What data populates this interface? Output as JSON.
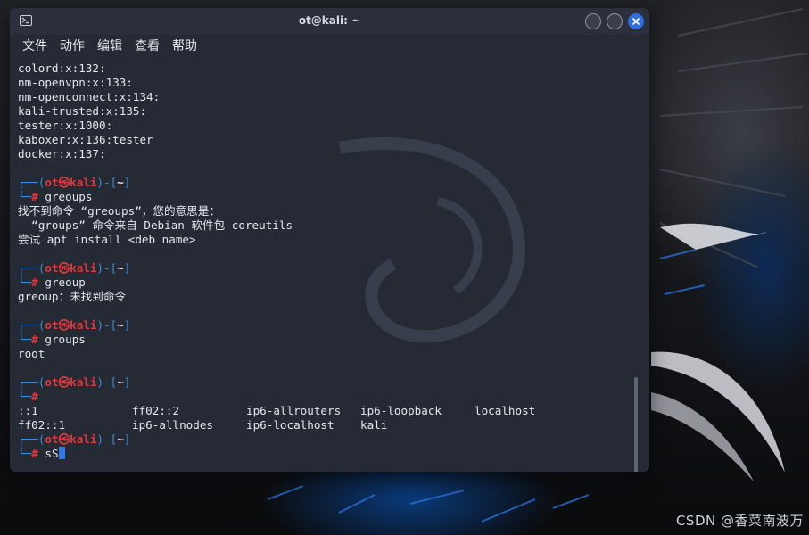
{
  "window": {
    "title": "ot@kali: ~",
    "icon": "terminal-icon",
    "controls": [
      "minimize-button",
      "maximize-button",
      "close-button"
    ]
  },
  "menu": [
    "文件",
    "动作",
    "编辑",
    "查看",
    "帮助"
  ],
  "prompt": {
    "user": "ot",
    "at_symbol": "㉿",
    "host": "kali",
    "dir": "~",
    "symbol": "#"
  },
  "output": {
    "group_lines": [
      "colord:x:132:",
      "nm-openvpn:x:133:",
      "nm-openconnect:x:134:",
      "kali-trusted:x:135:",
      "tester:x:1000:",
      "kaboxer:x:136:tester",
      "docker:x:137:"
    ],
    "cmd1": "greoups",
    "cmd1_out": [
      "找不到命令 “greoups”，您的意思是：",
      "  “groups” 命令来自 Debian 软件包 coreutils",
      "尝试 apt install <deb name>"
    ],
    "cmd2": "greoup",
    "cmd2_out": "greoup：未找到命令",
    "cmd3": "groups",
    "cmd3_out": "root",
    "cmd4": "",
    "completion_row1": [
      "::1",
      "ff02::2",
      "ip6-allrouters",
      "ip6-loopback",
      "localhost"
    ],
    "completion_row2": [
      "ff02::1",
      "ip6-allnodes",
      "ip6-localhost",
      "kali"
    ],
    "current_input": "sS"
  },
  "colors": {
    "prompt_bracket": "#3e8bd6",
    "prompt_user": "#e03a3a",
    "terminal_bg": "#252a35",
    "cursor": "#2f78e6",
    "close_button": "#2f6de1"
  },
  "watermark": "CSDN @香菜南波万"
}
